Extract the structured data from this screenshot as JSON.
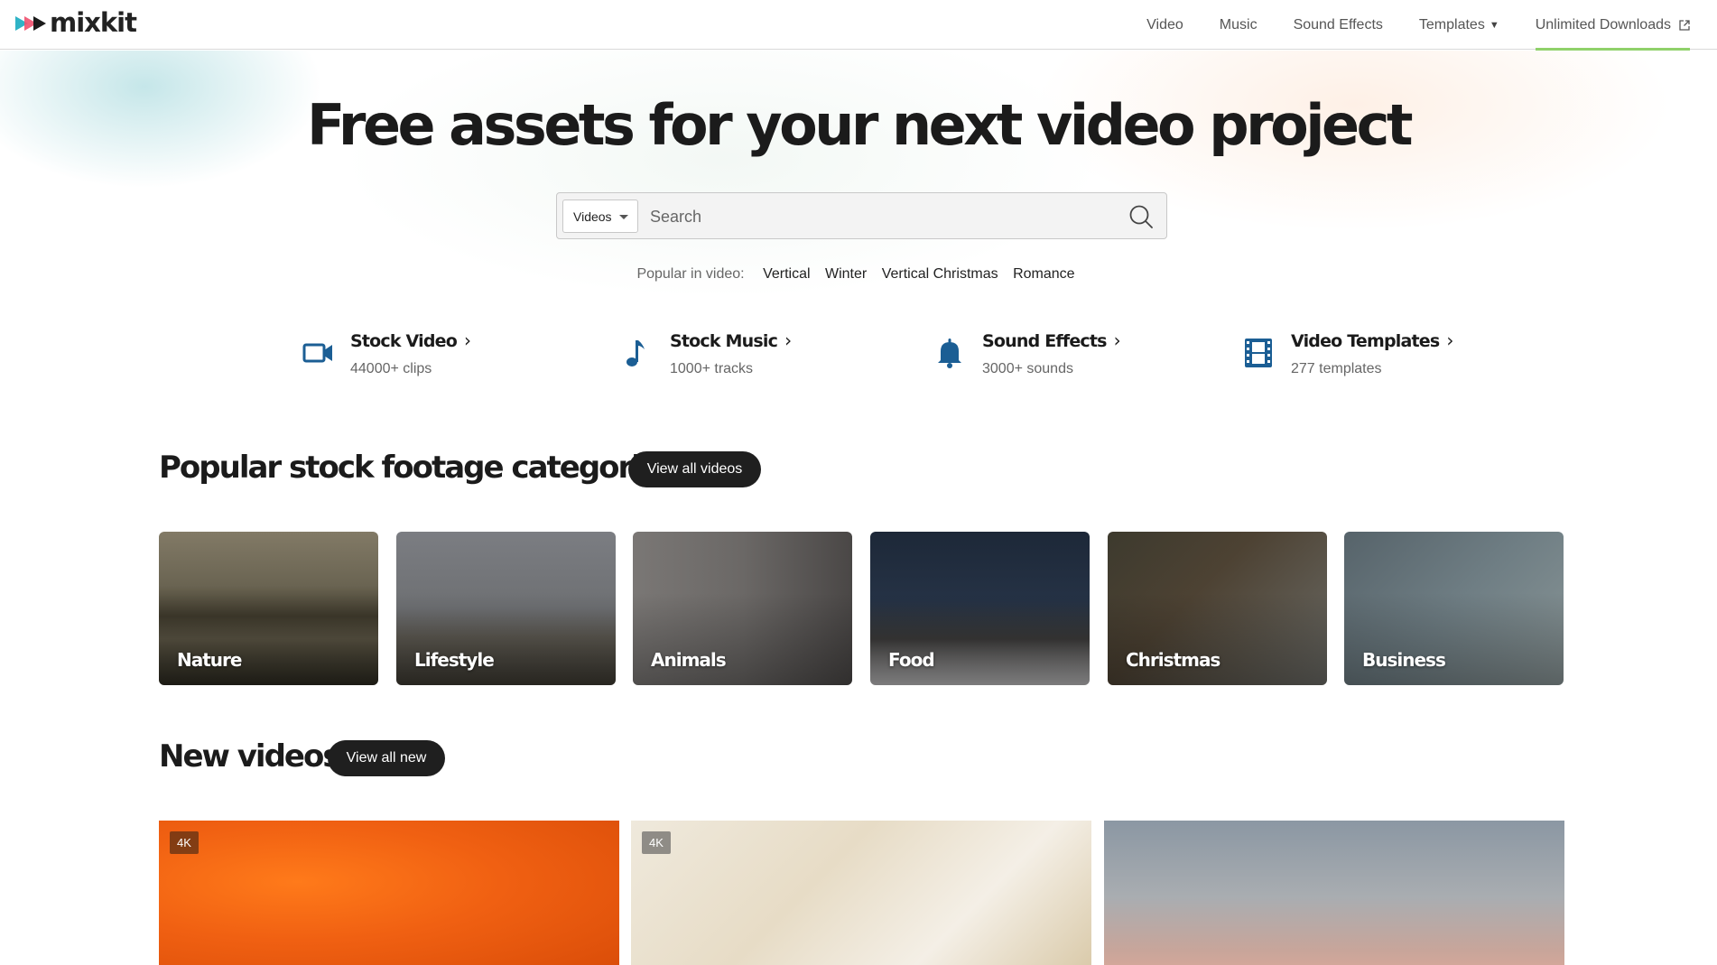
{
  "header": {
    "logo_text": "mixkit",
    "nav": [
      {
        "label": "Video"
      },
      {
        "label": "Music"
      },
      {
        "label": "Sound Effects"
      },
      {
        "label": "Templates"
      },
      {
        "label": "Unlimited Downloads"
      }
    ],
    "accent_color": "#8fd16a"
  },
  "hero": {
    "title": "Free assets for your next video project",
    "search": {
      "selected_type": "Videos",
      "placeholder": "Search",
      "value": ""
    },
    "popular_label": "Popular in video:",
    "popular_tags": [
      "Vertical",
      "Winter",
      "Vertical Christmas",
      "Romance"
    ]
  },
  "quick_categories": [
    {
      "title": "Stock Video",
      "subtitle": "44000+ clips",
      "icon": "video-camera-icon"
    },
    {
      "title": "Stock Music",
      "subtitle": "1000+ tracks",
      "icon": "music-note-icon"
    },
    {
      "title": "Sound Effects",
      "subtitle": "3000+ sounds",
      "icon": "bell-icon"
    },
    {
      "title": "Video Templates",
      "subtitle": "277 templates",
      "icon": "film-strip-icon"
    }
  ],
  "icon_color": "#1b5e94",
  "footage_section": {
    "title": "Popular stock footage categories",
    "button_label": "View all videos",
    "tiles": [
      "Nature",
      "Lifestyle",
      "Animals",
      "Food",
      "Christmas",
      "Business"
    ]
  },
  "new_videos_section": {
    "title": "New videos",
    "button_label": "View all new",
    "videos": [
      {
        "badge": "4K"
      },
      {
        "badge": "4K"
      },
      {
        "badge": ""
      }
    ]
  }
}
